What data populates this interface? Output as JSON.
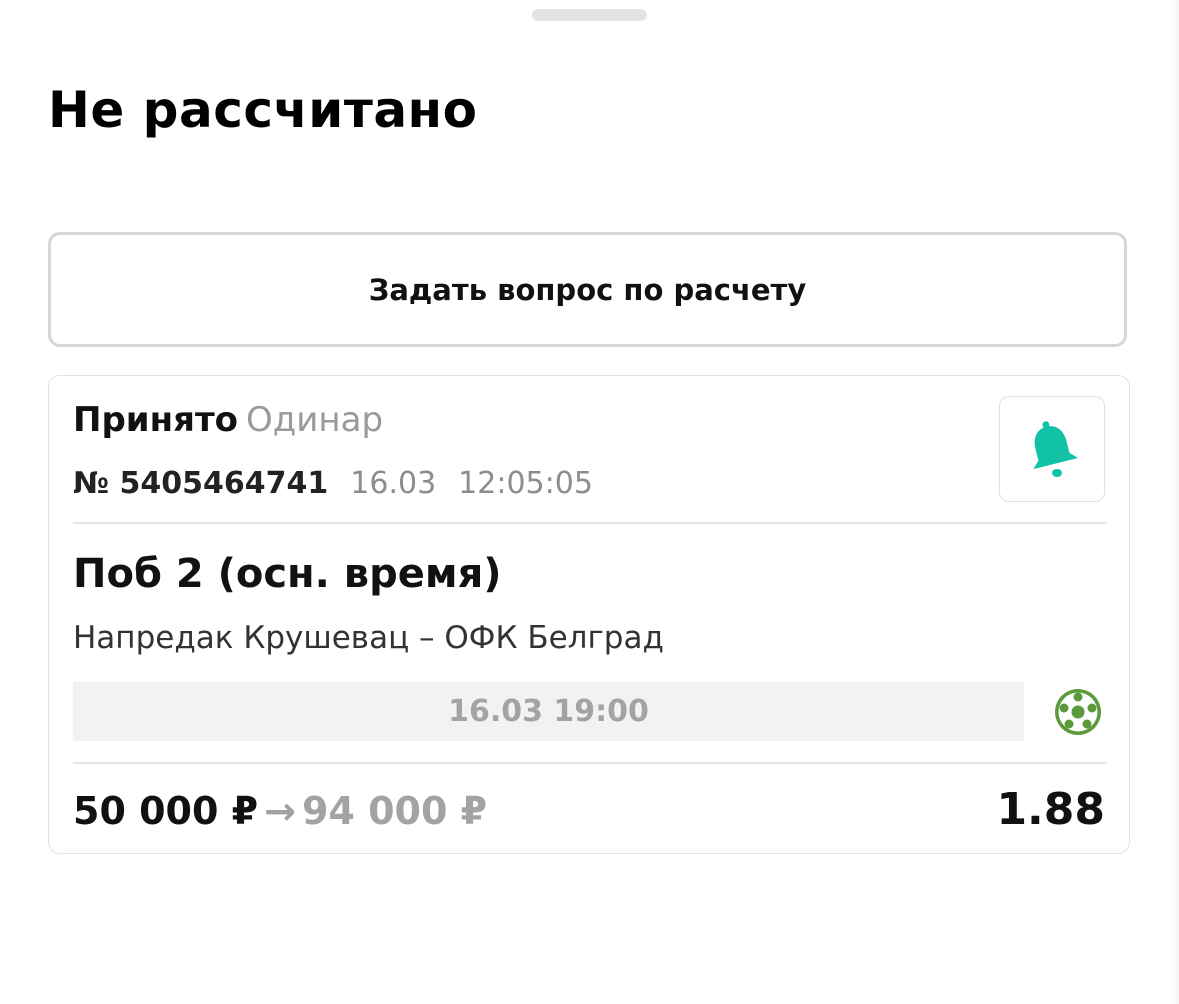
{
  "sheet": {
    "title": "Не рассчитано",
    "ask_button_label": "Задать вопрос по расчету"
  },
  "bet": {
    "status": "Принято",
    "bet_type": "Одинар",
    "number": "№ 5405464741",
    "date": "16.03",
    "time": "12:05:05",
    "outcome": "Поб 2 (осн. время)",
    "match": "Напредак Крушевац – ОФК Белград",
    "event_start": "16.03 19:00",
    "sport_icon": "football-icon",
    "notification_icon": "bell-icon",
    "stake": "50 000 ₽",
    "arrow": "→",
    "potential_payout": "94 000 ₽",
    "coefficient": "1.88"
  },
  "colors": {
    "accent_teal": "#12c2a6",
    "sport_green": "#5a9a3a",
    "muted_text": "#9a9a9a",
    "border": "#e3e3e3"
  }
}
